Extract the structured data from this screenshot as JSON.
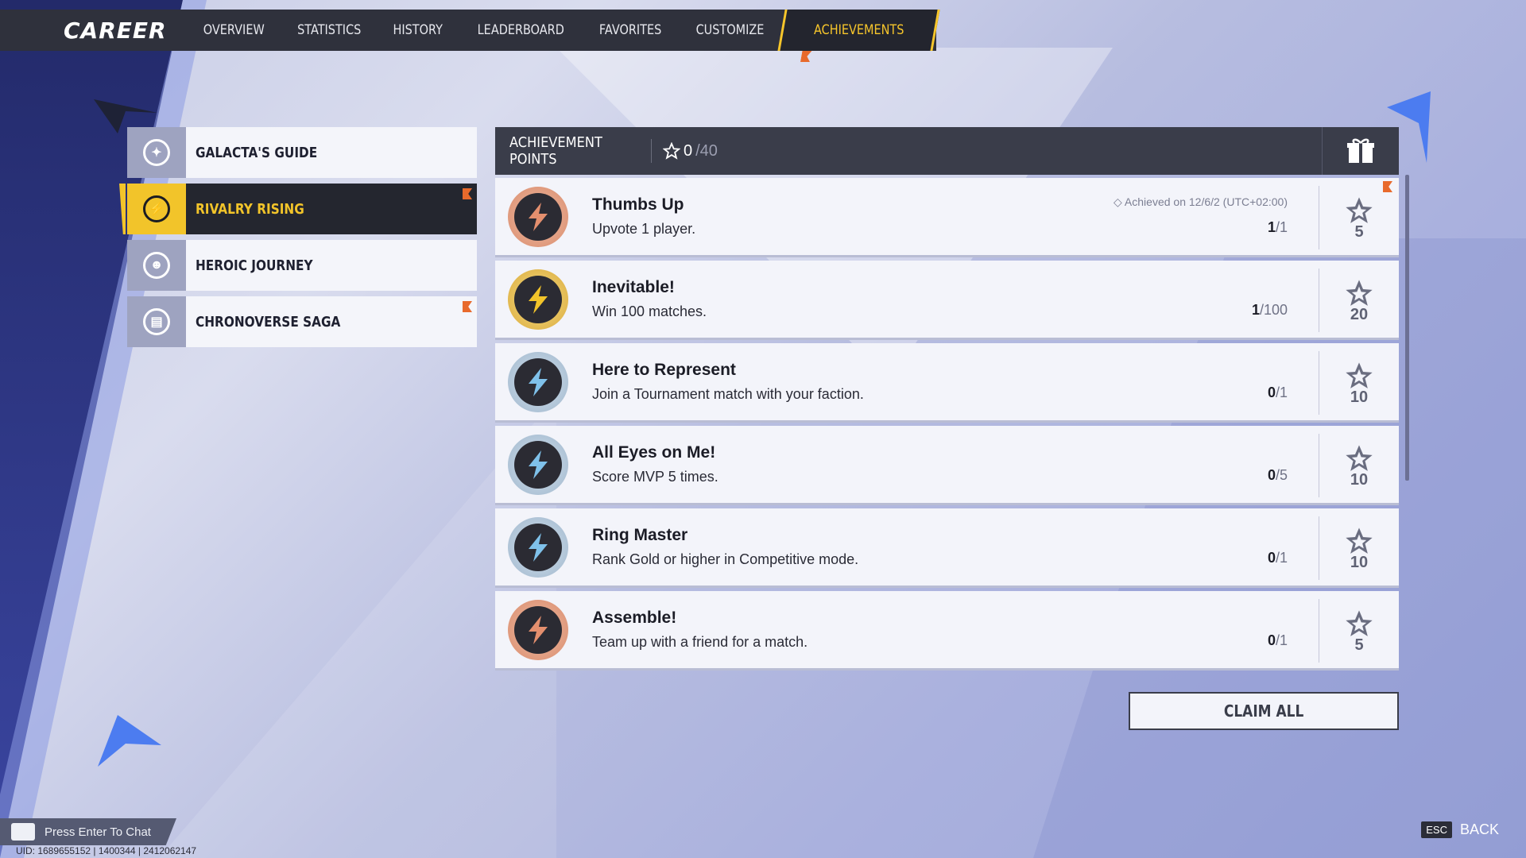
{
  "topnav": {
    "title": "CAREER",
    "tabs": [
      {
        "label": "OVERVIEW"
      },
      {
        "label": "STATISTICS"
      },
      {
        "label": "HISTORY"
      },
      {
        "label": "LEADERBOARD"
      },
      {
        "label": "FAVORITES"
      },
      {
        "label": "CUSTOMIZE"
      },
      {
        "label": "ACHIEVEMENTS",
        "active": true
      }
    ]
  },
  "menu": {
    "items": [
      {
        "label": "GALACTA'S GUIDE",
        "icon": "galacta-icon"
      },
      {
        "label": "RIVALRY RISING",
        "icon": "rivalry-icon",
        "active": true
      },
      {
        "label": "HEROIC JOURNEY",
        "icon": "journey-icon"
      },
      {
        "label": "CHRONOVERSE SAGA",
        "icon": "saga-icon"
      }
    ]
  },
  "panel": {
    "title": "ACHIEVEMENT POINTS",
    "points_current": "0",
    "points_total": "/40"
  },
  "achievements": [
    {
      "title": "Thumbs Up",
      "desc": "Upvote 1 player.",
      "date": "Achieved on 12/6/2 (UTC+02:00)",
      "current": "1",
      "total": "/1",
      "reward": "5",
      "badge": "bronze"
    },
    {
      "title": "Inevitable!",
      "desc": "Win 100 matches.",
      "date": "",
      "current": "1",
      "total": "/100",
      "reward": "20",
      "badge": "gold"
    },
    {
      "title": "Here to Represent",
      "desc": "Join a Tournament match with your faction.",
      "date": "",
      "current": "0",
      "total": "/1",
      "reward": "10",
      "badge": "silver"
    },
    {
      "title": "All Eyes on Me!",
      "desc": "Score MVP 5 times.",
      "date": "",
      "current": "0",
      "total": "/5",
      "reward": "10",
      "badge": "silver"
    },
    {
      "title": "Ring Master",
      "desc": "Rank Gold or higher in Competitive mode.",
      "date": "",
      "current": "0",
      "total": "/1",
      "reward": "10",
      "badge": "silver"
    },
    {
      "title": "Assemble!",
      "desc": "Team up with a friend for a match.",
      "date": "",
      "current": "0",
      "total": "/1",
      "reward": "5",
      "badge": "bronze"
    }
  ],
  "claim_all": "CLAIM ALL",
  "chat": "Press Enter To Chat",
  "uid": "UID: 1689655152 | 1400344 | 2412062147",
  "back": {
    "key": "ESC",
    "label": "BACK"
  },
  "colors": {
    "accent": "#f2c42a",
    "dark": "#2f313c",
    "flag": "#e86a2c"
  }
}
